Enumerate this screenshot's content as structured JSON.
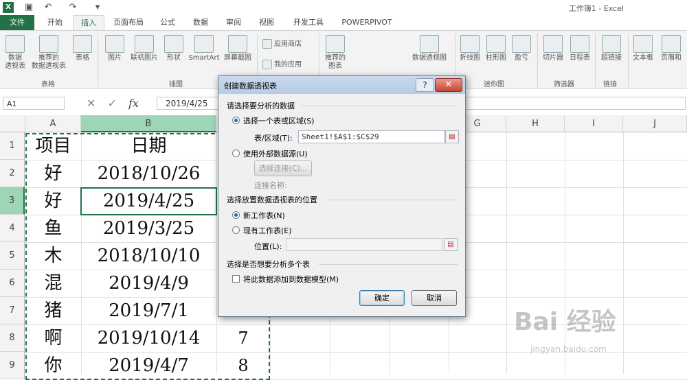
{
  "window": {
    "title": "工作簿1 - Excel"
  },
  "quick_access": {
    "icons": [
      "excel-logo-icon",
      "save-icon",
      "undo-icon",
      "redo-icon",
      "customize-icon"
    ]
  },
  "tabs": [
    "文件",
    "开始",
    "插入",
    "页面布局",
    "公式",
    "数据",
    "审阅",
    "视图",
    "开发工具",
    "POWERPIVOT"
  ],
  "ribbon": {
    "pivot_table": "数据\n透视表",
    "recommended_pivot": "推荐的\n数据透视表",
    "table": "表格",
    "picture": "图片",
    "online_picture": "联机图片",
    "shapes": "形状",
    "smartart": "SmartArt",
    "screenshot": "屏幕截图",
    "app_store": "应用商店",
    "my_apps": "我的应用",
    "recommended_charts": "推荐的\n图表",
    "pivot_chart": "数据透视图",
    "sparkline_line": "折线图",
    "sparkline_column": "柱形图",
    "sparkline_winloss": "盈亏",
    "slicer": "切片器",
    "timeline": "日程表",
    "hyperlink": "超链接",
    "textbox": "文本框",
    "header_footer": "页眉和",
    "groups": {
      "tables": "表格",
      "illustrations": "插图",
      "sparklines": "迷你图",
      "filters": "筛选器",
      "links": "链接"
    }
  },
  "formula_bar": {
    "name_box": "A1",
    "formula": "2019/4/25",
    "fx": "fx"
  },
  "sheet": {
    "columns": [
      "A",
      "B",
      "G",
      "H",
      "I",
      "J"
    ],
    "rows": [
      "1",
      "2",
      "3",
      "4",
      "5",
      "6",
      "7",
      "8",
      "9"
    ],
    "cells": [
      {
        "a": "项目",
        "b": "日期",
        "c": ""
      },
      {
        "a": "好",
        "b": "2018/10/26",
        "c": ""
      },
      {
        "a": "好",
        "b": "2019/4/25",
        "c": ""
      },
      {
        "a": "鱼",
        "b": "2019/3/25",
        "c": ""
      },
      {
        "a": "木",
        "b": "2018/10/10",
        "c": ""
      },
      {
        "a": "混",
        "b": "2019/4/9",
        "c": ""
      },
      {
        "a": "猪",
        "b": "2019/7/1",
        "c": ""
      },
      {
        "a": "啊",
        "b": "2019/10/14",
        "c": "7"
      },
      {
        "a": "你",
        "b": "2019/4/7",
        "c": "8"
      }
    ]
  },
  "dialog": {
    "title": "创建数据透视表",
    "help": "?",
    "close": "✕",
    "section1": "请选择要分析的数据",
    "opt_select_range": "选择一个表或区域(S)",
    "range_label": "表/区域(T):",
    "range_value": "Sheet1!$A$1:$C$29",
    "opt_external": "使用外部数据源(U)",
    "choose_connection": "选择连接(C)...",
    "connection_name": "连接名称:",
    "section2": "选择放置数据透视表的位置",
    "opt_new_sheet": "新工作表(N)",
    "opt_existing_sheet": "现有工作表(E)",
    "location_label": "位置(L):",
    "location_value": "",
    "section3": "选择是否想要分析多个表",
    "add_to_model": "将此数据添加到数据模型(M)",
    "ok": "确定",
    "cancel": "取消"
  },
  "watermark": {
    "brand": "Bai 经验",
    "url": "jingyan.baidu.com"
  }
}
